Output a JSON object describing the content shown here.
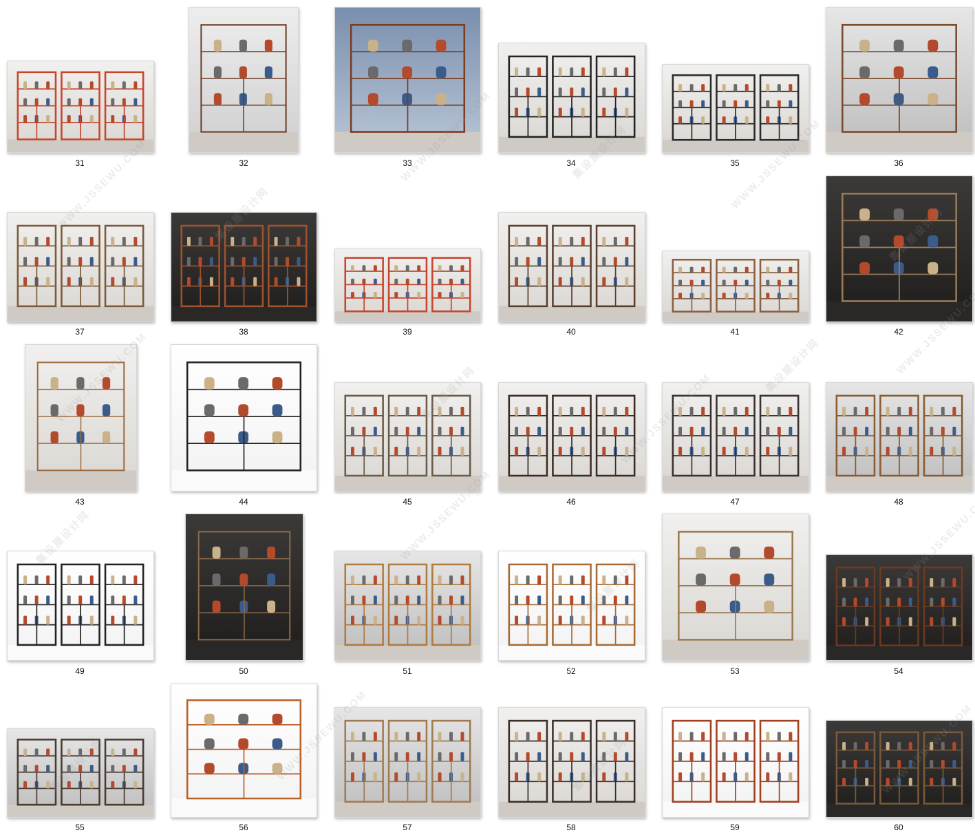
{
  "items": [
    {
      "label": "31",
      "theme": "light",
      "accent": "#c7452c"
    },
    {
      "label": "32",
      "theme": "wood",
      "accent": "#6b3a22"
    },
    {
      "label": "33",
      "theme": "blue",
      "accent": "#7a3d1f"
    },
    {
      "label": "34",
      "theme": "light",
      "accent": "#222222"
    },
    {
      "label": "35",
      "theme": "light",
      "accent": "#2a2a2a"
    },
    {
      "label": "36",
      "theme": "grey",
      "accent": "#7a4a2c"
    },
    {
      "label": "37",
      "theme": "light",
      "accent": "#7a5a38"
    },
    {
      "label": "38",
      "theme": "dark",
      "accent": "#a0522d"
    },
    {
      "label": "39",
      "theme": "light",
      "accent": "#c7452c"
    },
    {
      "label": "40",
      "theme": "light",
      "accent": "#5a3e2b"
    },
    {
      "label": "41",
      "theme": "light",
      "accent": "#8a6040"
    },
    {
      "label": "42",
      "theme": "dark",
      "accent": "#9a7a58"
    },
    {
      "label": "43",
      "theme": "light",
      "accent": "#9a6b40"
    },
    {
      "label": "44",
      "theme": "white",
      "accent": "#222222"
    },
    {
      "label": "45",
      "theme": "light",
      "accent": "#6a5a48"
    },
    {
      "label": "46",
      "theme": "light",
      "accent": "#3a2a22"
    },
    {
      "label": "47",
      "theme": "light",
      "accent": "#3a3030"
    },
    {
      "label": "48",
      "theme": "grey",
      "accent": "#8a5a30"
    },
    {
      "label": "49",
      "theme": "white",
      "accent": "#222222"
    },
    {
      "label": "50",
      "theme": "dark",
      "accent": "#8a6a4a"
    },
    {
      "label": "51",
      "theme": "grey",
      "accent": "#b07a40"
    },
    {
      "label": "52",
      "theme": "white",
      "accent": "#a86a34"
    },
    {
      "label": "53",
      "theme": "light",
      "accent": "#9a7a50"
    },
    {
      "label": "54",
      "theme": "dark",
      "accent": "#6a3a22"
    },
    {
      "label": "55",
      "theme": "grey",
      "accent": "#4a3a30"
    },
    {
      "label": "56",
      "theme": "white",
      "accent": "#b8602a"
    },
    {
      "label": "57",
      "theme": "grey",
      "accent": "#a07a50"
    },
    {
      "label": "58",
      "theme": "light",
      "accent": "#3a2e2a"
    },
    {
      "label": "59",
      "theme": "white",
      "accent": "#a0401e"
    },
    {
      "label": "60",
      "theme": "dark",
      "accent": "#7a5a3a"
    }
  ],
  "watermarks": [
    {
      "text": "WWW.JSSEWU.COM"
    },
    {
      "text": "集设屋设计网"
    }
  ]
}
